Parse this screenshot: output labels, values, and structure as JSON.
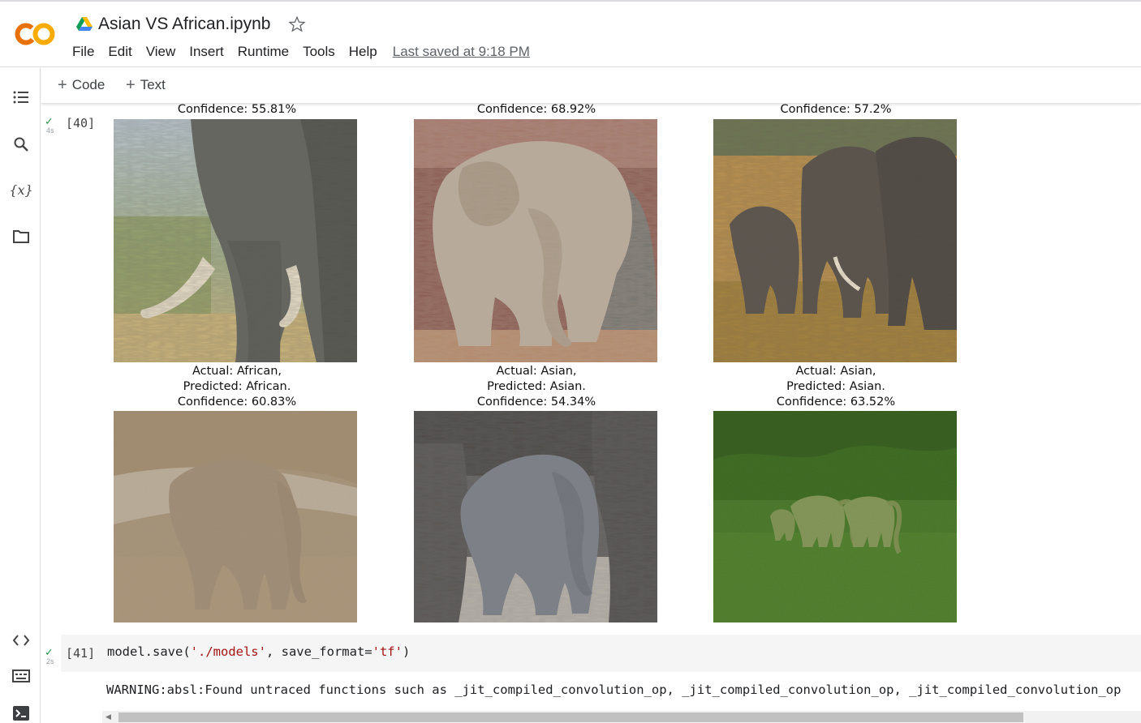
{
  "header": {
    "title": "Asian VS African.ipynb",
    "menu": [
      "File",
      "Edit",
      "View",
      "Insert",
      "Runtime",
      "Tools",
      "Help"
    ],
    "last_saved": "Last saved at 9:18 PM"
  },
  "toolbar": {
    "code_label": "Code",
    "text_label": "Text"
  },
  "left_rail": {
    "icons": [
      "table-of-contents-icon",
      "search-icon",
      "variables-icon",
      "files-icon",
      "code-snippets-icon",
      "command-palette-icon",
      "terminal-icon"
    ],
    "variables_glyph": "{x}"
  },
  "cell40": {
    "exec_count": "[40]",
    "exec_time": "4s",
    "panels": [
      {
        "caption": [
          "Confidence: 55.81%"
        ],
        "subject": "african-elephant-with-tusks"
      },
      {
        "caption": [
          "Confidence: 68.92%"
        ],
        "subject": "asian-elephant-by-rocks"
      },
      {
        "caption": [
          "Confidence: 57.2%"
        ],
        "subject": "elephant-herd-in-grassland"
      },
      {
        "caption": [
          "Actual: African,",
          "Predicted: African.",
          "Confidence: 60.83%"
        ],
        "subject": "young-african-elephant-on-mud"
      },
      {
        "caption": [
          "Actual: Asian,",
          "Predicted: Asian.",
          "Confidence: 54.34%"
        ],
        "subject": "asian-elephant-calf"
      },
      {
        "caption": [
          "Actual: Asian,",
          "Predicted: Asian.",
          "Confidence: 63.52%"
        ],
        "subject": "asian-elephants-in-forest-grass"
      }
    ]
  },
  "cell41": {
    "exec_count": "[41]",
    "exec_time": "2s",
    "code_prefix": "model.save(",
    "code_arg1": "'./models'",
    "code_mid": ", save_format=",
    "code_arg2": "'tf'",
    "code_suffix": ")",
    "output": "WARNING:absl:Found untraced functions such as _jit_compiled_convolution_op, _jit_compiled_convolution_op, _jit_compiled_convolution_op"
  },
  "colors": {
    "logo_orange": "#F9AB00",
    "logo_dark_orange": "#E8710A",
    "check_green": "#1e8e3e",
    "code_bg": "#f5f5f5"
  }
}
